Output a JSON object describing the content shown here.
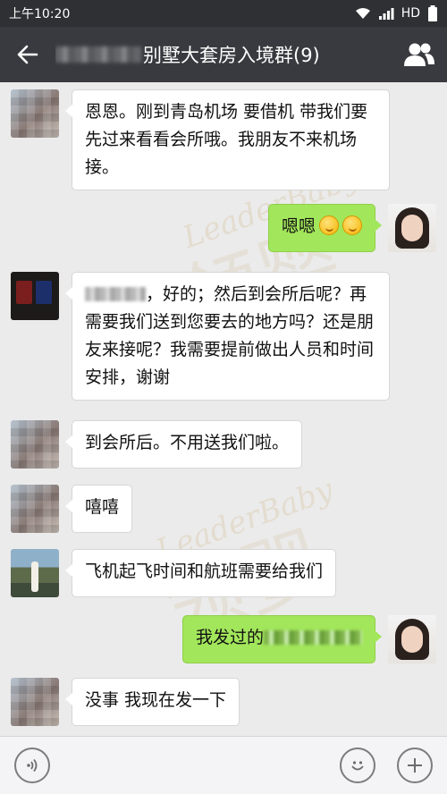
{
  "status_bar": {
    "time": "上午10:20",
    "network": "HD"
  },
  "header": {
    "title": "别墅大套房入境群(9)"
  },
  "watermarks": {
    "brand": "LeaderBaby",
    "glyph": "领婴"
  },
  "messages": [
    {
      "side": "in",
      "avatar": "mosaic",
      "text": "恩恩。刚到青岛机场 要借机 带我们要先过来看看会所哦。我朋友不来机场接。"
    },
    {
      "side": "out",
      "avatar": "self",
      "text": "嗯嗯",
      "emojis": 2
    },
    {
      "side": "in",
      "avatar": "passport",
      "mention": "@",
      "text": "，好的；然后到会所后呢？再需要我们送到您要去的地方吗？还是朋友来接呢？我需要提前做出人员和时间安排，谢谢"
    },
    {
      "side": "in",
      "avatar": "mosaic",
      "text": "到会所后。不用送我们啦。"
    },
    {
      "side": "in",
      "avatar": "mosaic",
      "text": "嘻嘻"
    },
    {
      "side": "in",
      "avatar": "outdoor",
      "text": "飞机起飞时间和航班需要给我们"
    },
    {
      "side": "out",
      "avatar": "self",
      "text": "我发过的"
    },
    {
      "side": "in",
      "avatar": "mosaic",
      "text": "没事 我现在发一下"
    }
  ]
}
